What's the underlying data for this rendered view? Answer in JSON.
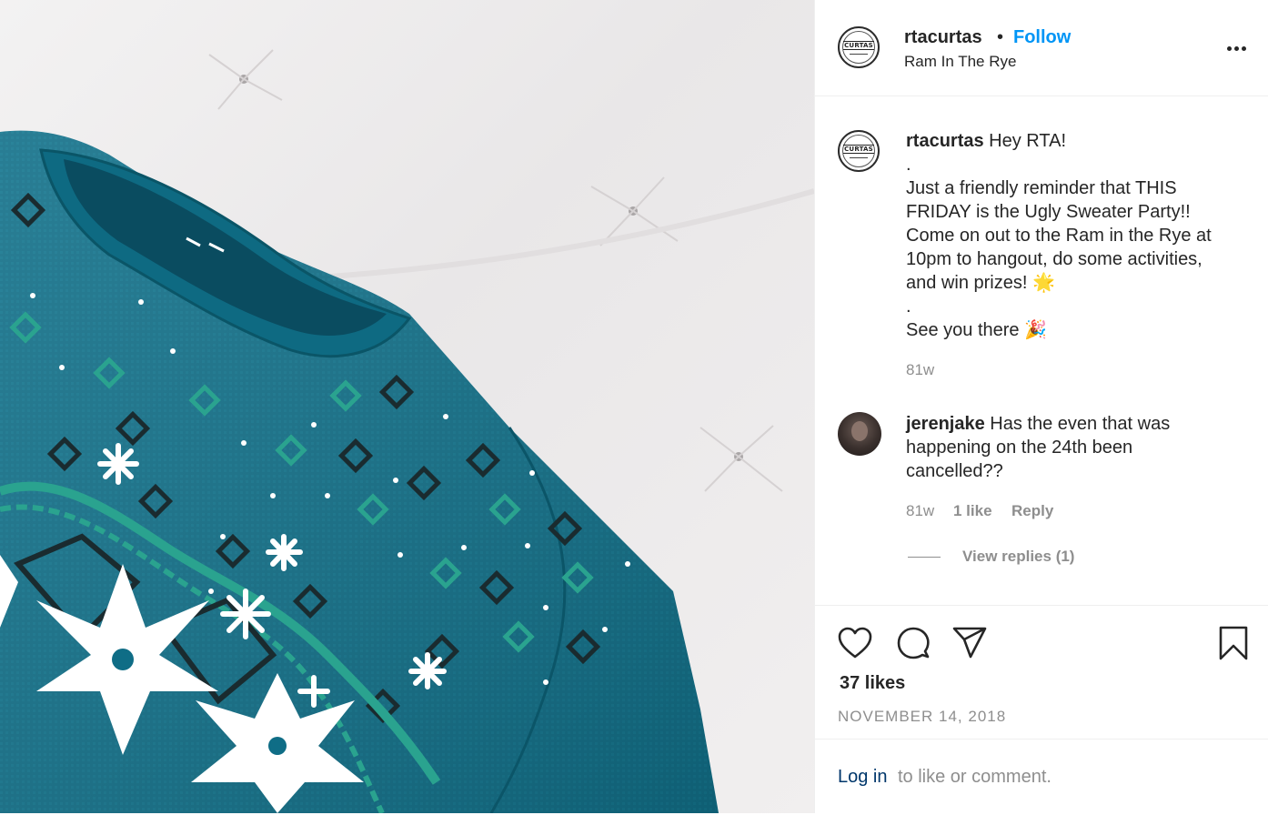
{
  "post": {
    "username": "rtacurtas",
    "separator": "•",
    "follow_label": "Follow",
    "location": "Ram In The Rye",
    "logo_text": "CURTAS",
    "caption": {
      "username": "rtacurtas",
      "lines": [
        "Hey RTA!",
        ".",
        "Just a friendly reminder that THIS",
        "FRIDAY is the Ugly Sweater Party!!",
        "Come on out to the Ram in the Rye at",
        "10pm to hangout, do some activities,",
        "and win prizes! 🌟",
        ".",
        "See you there 🎉"
      ],
      "age": "81w"
    },
    "comments": [
      {
        "username": "jerenjake",
        "lines": [
          "Has the even that was",
          "happening on the 24th been",
          "cancelled??"
        ],
        "age": "81w",
        "likes": "1 like",
        "reply_label": "Reply",
        "view_replies": "View replies (1)"
      }
    ],
    "likes": "37 likes",
    "date": "NOVEMBER 14, 2018",
    "login_link": "Log in",
    "login_rest": "to like or comment."
  },
  "icons": [
    "heart-icon",
    "comment-icon",
    "share-icon",
    "bookmark-icon",
    "more-options-icon"
  ],
  "colors": {
    "accent": "#0095f6",
    "link": "#00376b",
    "muted": "#8e8e8e",
    "text": "#262626",
    "sweater": "#0f6d86"
  }
}
